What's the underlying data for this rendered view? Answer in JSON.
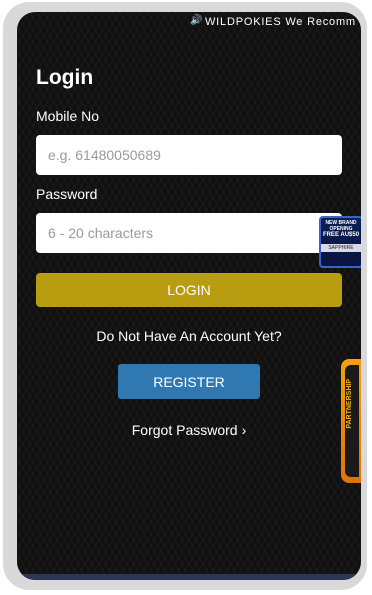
{
  "ticker": {
    "icon": "speaker-icon",
    "text": "WILDPOKIES We Recomm"
  },
  "login": {
    "title": "Login",
    "mobile_label": "Mobile No",
    "mobile_placeholder": "e.g. 61480050689",
    "mobile_value": "",
    "password_label": "Password",
    "password_placeholder": "6 - 20 characters",
    "password_value": "",
    "login_button": "LOGIN",
    "no_account_text": "Do Not Have An Account Yet?",
    "register_button": "REGISTER",
    "forgot_password": "Forgot Password"
  },
  "promos": {
    "first": {
      "line1": "NEW BRAND OPENING",
      "line2": "FREE AU$50",
      "line3": "SAPPHIRE"
    },
    "second": {
      "text": "PARTNERSHIP"
    }
  },
  "colors": {
    "background": "#101010",
    "login_button": "#b79d0f",
    "register_button": "#2f78b2"
  }
}
